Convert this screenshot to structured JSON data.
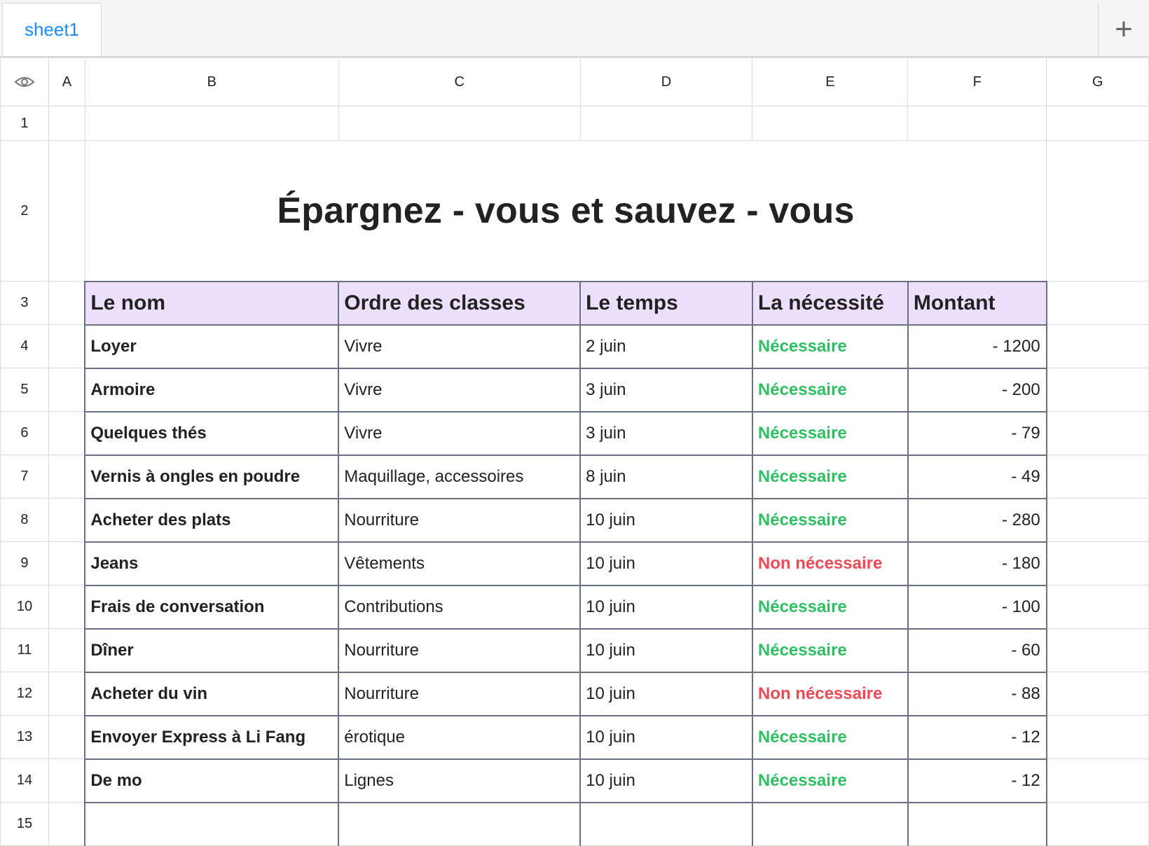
{
  "tabs": [
    {
      "label": "sheet1"
    }
  ],
  "add_tab_glyph": "+",
  "columns": [
    "A",
    "B",
    "C",
    "D",
    "E",
    "F",
    "G"
  ],
  "rows": [
    "1",
    "2",
    "3",
    "4",
    "5",
    "6",
    "7",
    "8",
    "9",
    "10",
    "11",
    "12",
    "13",
    "14",
    "15"
  ],
  "title": "Épargnez - vous et sauvez - vous",
  "headers": [
    "Le nom",
    "Ordre des classes",
    "Le temps",
    "La nécessité",
    "Montant"
  ],
  "data": [
    {
      "nom": "Loyer",
      "classe": "Vivre",
      "temps": "2 juin",
      "necessite": "Nécessaire",
      "montant": "- 1200"
    },
    {
      "nom": "Armoire",
      "classe": "Vivre",
      "temps": "3 juin",
      "necessite": "Nécessaire",
      "montant": "- 200"
    },
    {
      "nom": "Quelques thés",
      "classe": "Vivre",
      "temps": "3 juin",
      "necessite": "Nécessaire",
      "montant": "- 79"
    },
    {
      "nom": "Vernis à ongles en poudre",
      "classe": "Maquillage, accessoires",
      "temps": "8 juin",
      "necessite": "Nécessaire",
      "montant": "- 49"
    },
    {
      "nom": "Acheter des plats",
      "classe": "Nourriture",
      "temps": "10 juin",
      "necessite": "Nécessaire",
      "montant": "- 280"
    },
    {
      "nom": "Jeans",
      "classe": "Vêtements",
      "temps": "10 juin",
      "necessite": "Non nécessaire",
      "montant": "- 180"
    },
    {
      "nom": "Frais de conversation",
      "classe": "Contributions",
      "temps": "10 juin",
      "necessite": "Nécessaire",
      "montant": "- 100"
    },
    {
      "nom": "Dîner",
      "classe": "Nourriture",
      "temps": "10 juin",
      "necessite": "Nécessaire",
      "montant": "- 60"
    },
    {
      "nom": "Acheter du vin",
      "classe": "Nourriture",
      "temps": "10 juin",
      "necessite": "Non nécessaire",
      "montant": "- 88"
    },
    {
      "nom": "Envoyer Express à Li Fang",
      "classe": "érotique",
      "temps": "10 juin",
      "necessite": "Nécessaire",
      "montant": "- 12"
    },
    {
      "nom": "De mo",
      "classe": "Lignes",
      "temps": "10 juin",
      "necessite": "Nécessaire",
      "montant": "- 12"
    }
  ],
  "colors": {
    "necessary": "#2fbf63",
    "not_necessary": "#ee4a55",
    "header_bg": "#ede0ff",
    "tab_text": "#1a8cff"
  },
  "icons": {
    "visibility": "eye-icon",
    "add": "plus-icon"
  }
}
